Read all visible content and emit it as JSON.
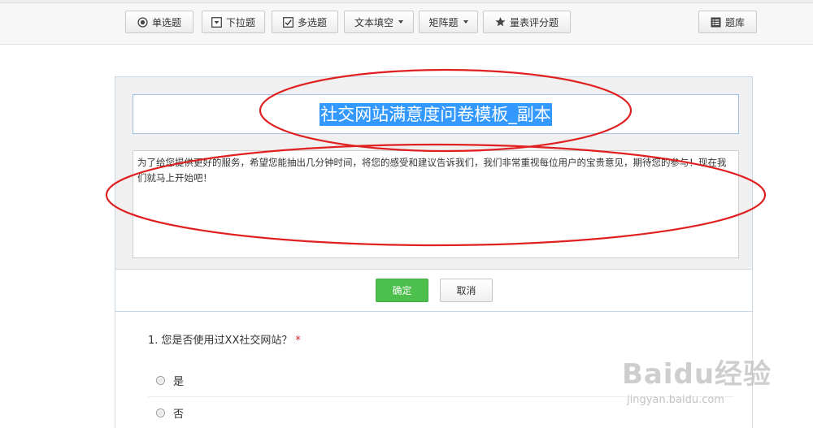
{
  "toolbar": {
    "single_choice": "单选题",
    "dropdown": "下拉题",
    "multi_choice": "多选题",
    "text_fill": "文本填空",
    "matrix": "矩阵题",
    "rating_scale": "量表评分题",
    "question_bank": "题库"
  },
  "editor": {
    "title": "社交网站满意度问卷模板_副本",
    "description": "为了给您提供更好的服务，希望您能抽出几分钟时间，将您的感受和建议告诉我们，我们非常重视每位用户的宝贵意见，期待您的参与！现在我们就马上开始吧！",
    "confirm_label": "确定",
    "cancel_label": "取消"
  },
  "question": {
    "title": "1. 您是否使用过XX社交网站？",
    "required_mark": "*",
    "options": [
      "是",
      "否"
    ]
  },
  "watermark": {
    "logo": "Baidu经验",
    "url": "jingyan.baidu.com"
  },
  "colors": {
    "confirm_green": "#4cbf4c",
    "selection_blue": "#3399ff",
    "annotation_red": "#e02020",
    "required_red": "#e02020"
  }
}
